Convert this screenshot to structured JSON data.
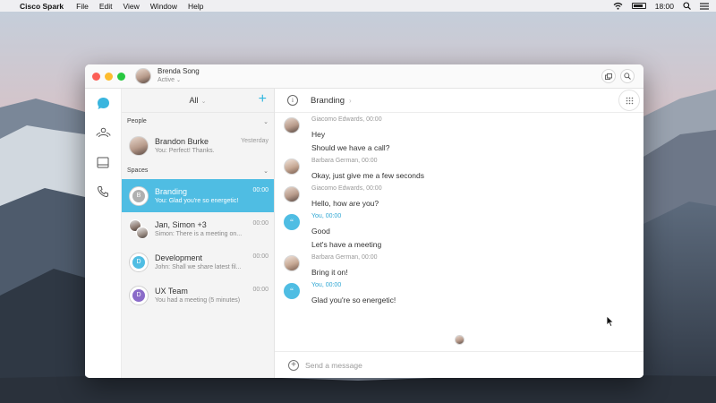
{
  "menubar": {
    "app_name": "Cisco Spark",
    "menus": [
      "File",
      "Edit",
      "View",
      "Window",
      "Help"
    ],
    "clock": "18:00"
  },
  "titlebar": {
    "user_name": "Brenda Song",
    "status": "Active"
  },
  "list": {
    "filter": "All",
    "people_header": "People",
    "spaces_header": "Spaces",
    "people": [
      {
        "name": "Brandon Burke",
        "snippet": "You: Perfect! Thanks.",
        "time": "Yesterday"
      }
    ],
    "spaces": [
      {
        "name": "Branding",
        "snippet": "You: Glad you're so energetic!",
        "time": "00:00",
        "initial": "B",
        "color": "#b0b0b0"
      },
      {
        "name": "Jan, Simon +3",
        "snippet": "Simon: There is a meeting on...",
        "time": "00:00"
      },
      {
        "name": "Development",
        "snippet": "John: Shall we share latest fil...",
        "time": "00:00",
        "initial": "D",
        "color": "#4fbde3"
      },
      {
        "name": "UX Team",
        "snippet": "You had a meeting (5 minutes)",
        "time": "00:00",
        "initial": "D",
        "color": "#8a6bc9"
      }
    ]
  },
  "conversation": {
    "title": "Branding",
    "messages": [
      {
        "sender": "Giacomo Edwards, 00:00",
        "lines": [
          "Hey",
          "Should we have a call?"
        ],
        "you": false
      },
      {
        "sender": "Barbara German, 00:00",
        "lines": [
          "Okay, just give me a few seconds"
        ],
        "you": false
      },
      {
        "sender": "Giacomo Edwards, 00:00",
        "lines": [
          "Hello, how are you?"
        ],
        "you": false
      },
      {
        "sender": "You, 00:00",
        "lines": [
          "Good",
          "Let's have a meeting"
        ],
        "you": true
      },
      {
        "sender": "Barbara German, 00:00",
        "lines": [
          "Bring it on!"
        ],
        "you": false
      },
      {
        "sender": "You, 00:00",
        "lines": [
          "Glad you're so energetic!"
        ],
        "you": true
      }
    ],
    "composer_placeholder": "Send a message"
  },
  "colors": {
    "accent": "#4fbde3",
    "plus": "#2fb7e0"
  }
}
